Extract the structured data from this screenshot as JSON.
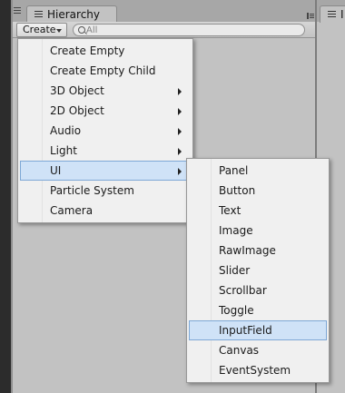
{
  "tab": {
    "title": "Hierarchy"
  },
  "right_tab": {
    "title": "I"
  },
  "toolbar": {
    "create_label": "Create",
    "search_placeholder": "All"
  },
  "create_menu": {
    "items": [
      {
        "label": "Create Empty",
        "submenu": false
      },
      {
        "label": "Create Empty Child",
        "submenu": false
      },
      {
        "label": "3D Object",
        "submenu": true
      },
      {
        "label": "2D Object",
        "submenu": true
      },
      {
        "label": "Audio",
        "submenu": true
      },
      {
        "label": "Light",
        "submenu": true
      },
      {
        "label": "UI",
        "submenu": true,
        "highlighted": true
      },
      {
        "label": "Particle System",
        "submenu": false
      },
      {
        "label": "Camera",
        "submenu": false
      }
    ]
  },
  "ui_submenu": {
    "items": [
      {
        "label": "Panel"
      },
      {
        "label": "Button"
      },
      {
        "label": "Text"
      },
      {
        "label": "Image"
      },
      {
        "label": "RawImage"
      },
      {
        "label": "Slider"
      },
      {
        "label": "Scrollbar"
      },
      {
        "label": "Toggle"
      },
      {
        "label": "InputField",
        "highlighted": true
      },
      {
        "label": "Canvas"
      },
      {
        "label": "EventSystem"
      }
    ]
  },
  "colors": {
    "highlight_bg": "#cfe2f7",
    "highlight_border": "#7ea8d6",
    "menu_bg": "#f0f0f0",
    "panel_bg": "#c2c2c2"
  }
}
